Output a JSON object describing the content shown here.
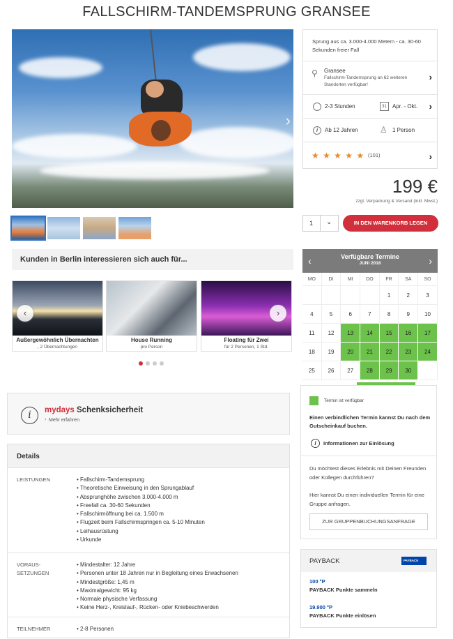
{
  "title": "FALLSCHIRM-TANDEMSPRUNG GRANSEE",
  "info": {
    "description": "Sprung aus ca. 3.000-4.000 Metern - ca. 30-60 Sekunden freier Fall",
    "location": "Gransee",
    "location_sub": "Fallschirm-Tandemsprung an 62 weiteren Standorten verfügbar!",
    "duration": "2-3 Stunden",
    "season": "Apr. - Okt.",
    "age": "Ab 12 Jahren",
    "persons": "1 Person",
    "stars": "★ ★ ★ ★ ★",
    "rating_count": "(101)",
    "calendar_icon_text": "31"
  },
  "price": "199 €",
  "price_note": "zzgl. Verpackung & Versand (inkl. Mwst.)",
  "quantity": "1",
  "cart_label": "IN DEN WARENKORB LEGEN",
  "interest_title": "Kunden in Berlin interessieren sich auch für...",
  "cards": [
    {
      "title": "Außergewöhnlich Übernachten",
      "sub": ", 2 Übernachtungen"
    },
    {
      "title": "House Running",
      "sub": "pro Person"
    },
    {
      "title": "Floating für Zwei",
      "sub": "für 2 Personen, 1 Std."
    }
  ],
  "calendar": {
    "title": "Verfügbare Termine",
    "month": "JUNI 2018",
    "days": [
      "MO",
      "DI",
      "MI",
      "DO",
      "FR",
      "SA",
      "SO"
    ],
    "cells": [
      {
        "d": "",
        "a": false
      },
      {
        "d": "",
        "a": false
      },
      {
        "d": "",
        "a": false
      },
      {
        "d": "",
        "a": false
      },
      {
        "d": "1",
        "a": false
      },
      {
        "d": "2",
        "a": false
      },
      {
        "d": "3",
        "a": false
      },
      {
        "d": "4",
        "a": false
      },
      {
        "d": "5",
        "a": false
      },
      {
        "d": "6",
        "a": false
      },
      {
        "d": "7",
        "a": false
      },
      {
        "d": "8",
        "a": false
      },
      {
        "d": "9",
        "a": false
      },
      {
        "d": "10",
        "a": false
      },
      {
        "d": "11",
        "a": false
      },
      {
        "d": "12",
        "a": false
      },
      {
        "d": "13",
        "a": true
      },
      {
        "d": "14",
        "a": true
      },
      {
        "d": "15",
        "a": true
      },
      {
        "d": "16",
        "a": true
      },
      {
        "d": "17",
        "a": true
      },
      {
        "d": "18",
        "a": false
      },
      {
        "d": "19",
        "a": false
      },
      {
        "d": "20",
        "a": true
      },
      {
        "d": "21",
        "a": true
      },
      {
        "d": "22",
        "a": true
      },
      {
        "d": "23",
        "a": true
      },
      {
        "d": "24",
        "a": true
      },
      {
        "d": "25",
        "a": false
      },
      {
        "d": "26",
        "a": false
      },
      {
        "d": "27",
        "a": false
      },
      {
        "d": "28",
        "a": true
      },
      {
        "d": "29",
        "a": true
      },
      {
        "d": "30",
        "a": true
      },
      {
        "d": "",
        "a": false
      }
    ]
  },
  "safe": {
    "brand": "mydays",
    "title": "Schenksicherheit",
    "link": "Mehr erfahren"
  },
  "details": {
    "heading": "Details",
    "rows": [
      {
        "label": "LEISTUNGEN",
        "items": [
          "Fallschirm-Tandemsprung",
          "Theoretische Einweisung in den Sprungablauf",
          "Absprunghöhe zwischen 3.000-4.000 m",
          "Freefall ca. 30-60 Sekunden",
          "Fallschirmöffnung bei ca. 1.500 m",
          "Flugzeit beim Fallschirmspringen ca. 5-10 Minuten",
          "Leihausrüstung",
          "Urkunde"
        ]
      },
      {
        "label": "VORAUS-\nSETZUNGEN",
        "items": [
          "Mindestalter: 12 Jahre",
          "Personen unter 18 Jahren nur in Begleitung eines Erwachsenen",
          "Mindestgröße: 1,45 m",
          "Maximalgewicht: 95 kg",
          "Normale physische Verfassung",
          "Keine Herz-, Kreislauf-, Rücken- oder Kniebeschwerden"
        ]
      },
      {
        "label": "TEILNEHMER",
        "items": [
          "2-8 Personen"
        ]
      }
    ]
  },
  "side": {
    "legend": "Termin ist verfügbar",
    "booking_note": "Einen verbindlichen Termin kannst Du nach dem Gutscheinkauf buchen.",
    "redeem_info": "Informationen zur Einlösung",
    "group_q": "Du möchtest dieses Erlebnis mit Deinen Freunden oder Kollegen durchführen?",
    "group_text": "Hier kannst Du einen individuellen Termin für eine Gruppe anfragen.",
    "group_button": "ZUR GRUPPENBUCHUNGSANFRAGE"
  },
  "payback": {
    "title": "PAYBACK",
    "logo": "PAYBACK",
    "collect_points": "100 °P",
    "collect_label": "PAYBACK Punkte sammeln",
    "redeem_points": "19.900 °P",
    "redeem_label": "PAYBACK Punkte einlösen"
  },
  "colors": {
    "accent": "#d12f3b",
    "available": "#6cc24a",
    "calendar_header": "#7b7b7b",
    "payback": "#0046aa"
  }
}
